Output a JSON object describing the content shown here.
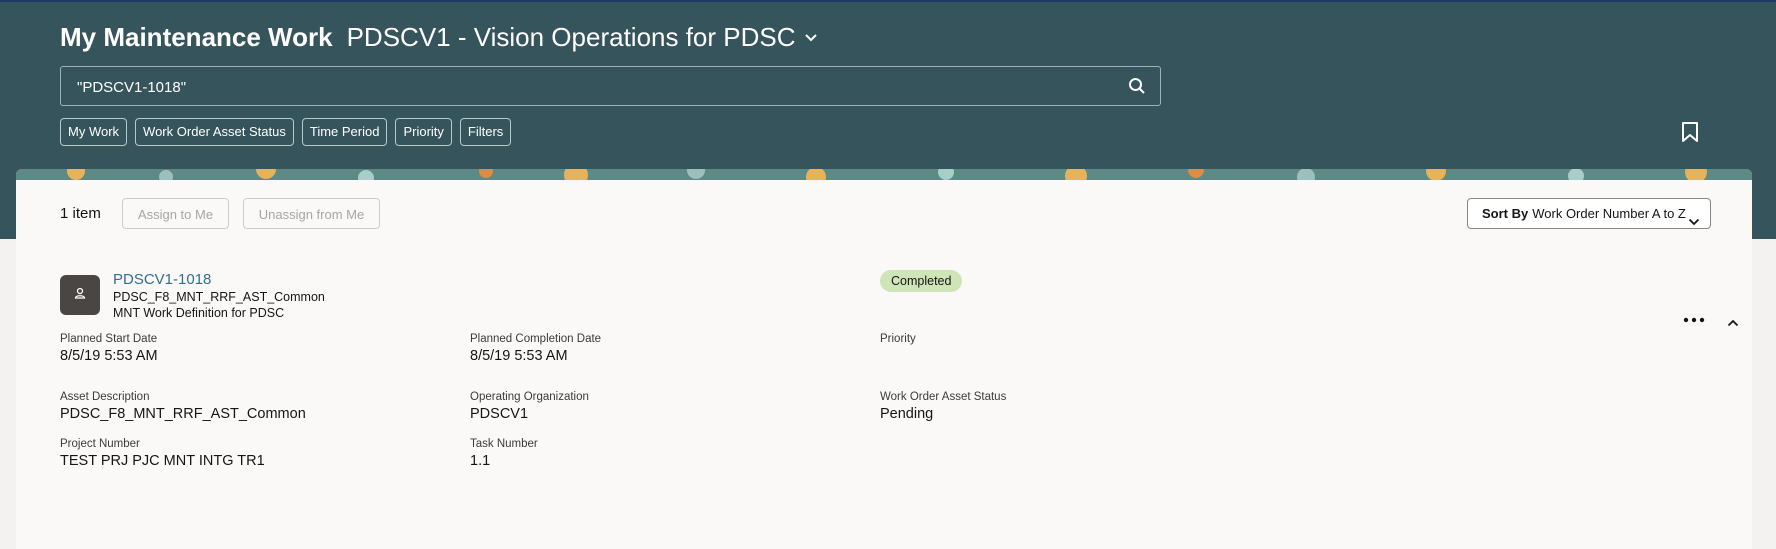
{
  "header": {
    "app_title": "My Maintenance Work",
    "organization": "PDSCV1 - Vision Operations for PDSC",
    "search_value": "\"PDSCV1-1018\"",
    "filter_chips": [
      "My Work",
      "Work Order Asset Status",
      "Time Period",
      "Priority",
      "Filters"
    ]
  },
  "toolbar": {
    "item_count": "1 item",
    "assign_label": "Assign to Me",
    "unassign_label": "Unassign from Me",
    "sort_by_label": "Sort By",
    "sort_value": "Work Order Number A to Z"
  },
  "work_order": {
    "number": "PDSCV1-1018",
    "asset": "PDSC_F8_MNT_RRF_AST_Common",
    "work_definition": "MNT Work Definition for PDSC",
    "status": "Completed",
    "fields": {
      "planned_start": {
        "label": "Planned Start Date",
        "value": "8/5/19 5:53 AM"
      },
      "planned_completion": {
        "label": "Planned Completion Date",
        "value": "8/5/19 5:53 AM"
      },
      "priority": {
        "label": "Priority",
        "value": ""
      },
      "asset_description": {
        "label": "Asset Description",
        "value": "PDSC_F8_MNT_RRF_AST_Common"
      },
      "operating_org": {
        "label": "Operating Organization",
        "value": "PDSCV1"
      },
      "asset_status": {
        "label": "Work Order Asset Status",
        "value": "Pending"
      },
      "project_number": {
        "label": "Project Number",
        "value": "TEST PRJ PJC MNT INTG TR1"
      },
      "task_number": {
        "label": "Task Number",
        "value": "1.1"
      }
    }
  },
  "colors": {
    "header_bg": "#36545b",
    "link": "#2f6f8f",
    "status_badge": "#cfe5b8",
    "panel_bg": "#fbf9f8"
  },
  "icons": [
    "chevron-down-icon",
    "search-icon",
    "bookmark-icon",
    "person-icon",
    "more-icon",
    "chevron-up-icon"
  ]
}
